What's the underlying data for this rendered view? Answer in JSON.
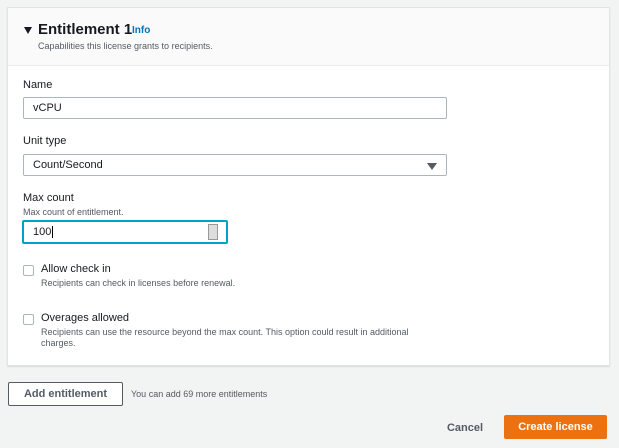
{
  "entitlement": {
    "title": "Entitlement 1",
    "info": "Info",
    "description": "Capabilities this license grants to recipients."
  },
  "name": {
    "label": "Name",
    "value": "vCPU"
  },
  "unit_type": {
    "label": "Unit type",
    "value": "Count/Second"
  },
  "max_count": {
    "label": "Max count",
    "description": "Max count of entitlement.",
    "value": "100"
  },
  "allow_check_in": {
    "label": "Allow check in",
    "description": "Recipients can check in licenses before renewal.",
    "checked": false
  },
  "overages": {
    "label": "Overages allowed",
    "description": "Recipients can use the resource beyond the max count. This option could result in additional charges.",
    "checked": false
  },
  "add_entitlement": {
    "label": "Add entitlement",
    "hint": "You can add 69 more entitlements"
  },
  "footer": {
    "cancel": "Cancel",
    "create": "Create license"
  },
  "colors": {
    "accent": "#ec7211",
    "focus": "#00a1c9",
    "link": "#0073bb"
  }
}
